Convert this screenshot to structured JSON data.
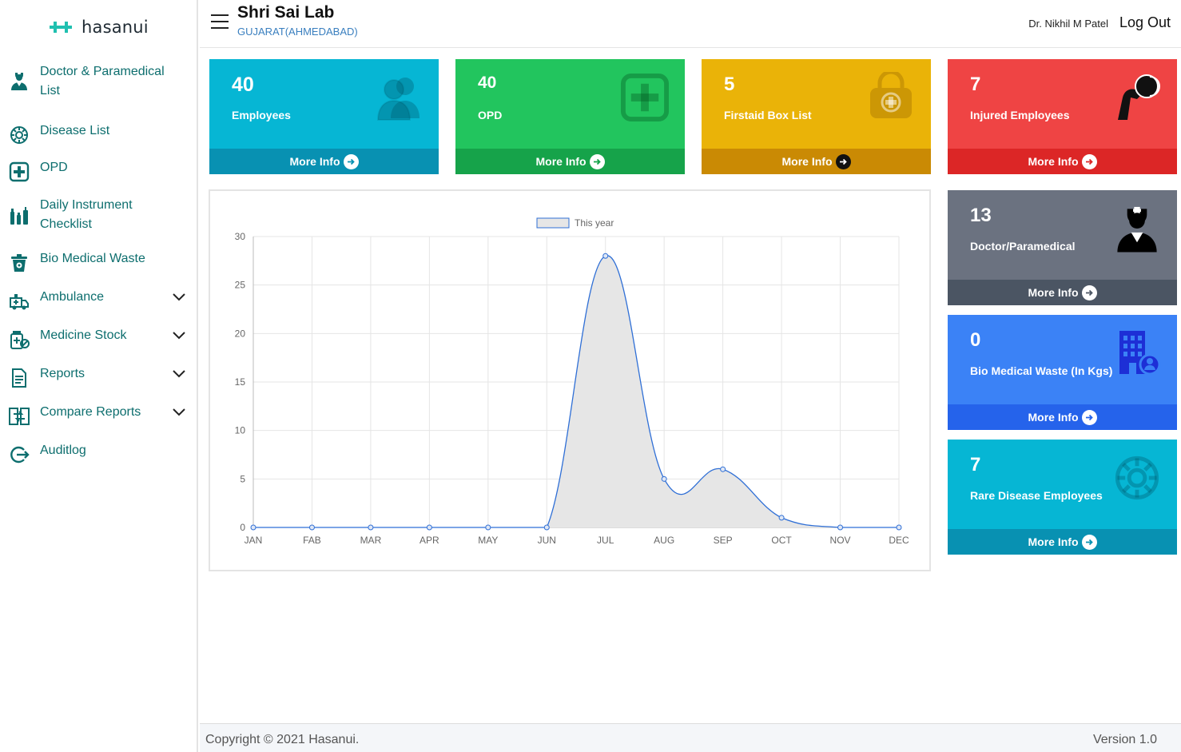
{
  "brand": {
    "name": "hasanui"
  },
  "sidebar": {
    "items": [
      {
        "label": "Doctor & Paramedical List",
        "icon": "doctor-icon",
        "has_chevron": false
      },
      {
        "label": "Disease List",
        "icon": "virus-icon",
        "has_chevron": false
      },
      {
        "label": "OPD",
        "icon": "medical-plus-icon",
        "has_chevron": false
      },
      {
        "label": "Daily Instrument Checklist",
        "icon": "instruments-icon",
        "has_chevron": false
      },
      {
        "label": "Bio Medical Waste",
        "icon": "waste-bin-icon",
        "has_chevron": false
      },
      {
        "label": "Ambulance",
        "icon": "ambulance-icon",
        "has_chevron": true
      },
      {
        "label": "Medicine Stock",
        "icon": "medicine-icon",
        "has_chevron": true
      },
      {
        "label": "Reports",
        "icon": "report-icon",
        "has_chevron": true
      },
      {
        "label": "Compare Reports",
        "icon": "compare-icon",
        "has_chevron": true
      },
      {
        "label": "Auditlog",
        "icon": "logout-arrow-icon",
        "has_chevron": false
      }
    ]
  },
  "header": {
    "title": "Shri Sai Lab",
    "subtitle": "GUJARAT(AHMEDABAD)",
    "user": "Dr. Nikhil M Patel",
    "logout": "Log Out"
  },
  "cards": [
    {
      "value": "40",
      "label": "Employees",
      "more": "More Info",
      "color": "#06b6d4",
      "footer_color": "#0891b2",
      "icon": "users-icon"
    },
    {
      "value": "40",
      "label": "OPD",
      "more": "More Info",
      "color": "#22c55e",
      "footer_color": "#16a34a",
      "icon": "medical-plus-icon"
    },
    {
      "value": "5",
      "label": "Firstaid Box List",
      "more": "More Info",
      "color": "#eab308",
      "footer_color": "#ca8a04",
      "icon": "firstaid-bag-icon"
    },
    {
      "value": "7",
      "label": "Injured Employees",
      "more": "More Info",
      "color": "#ef4444",
      "footer_color": "#dc2626",
      "icon": "injured-arm-icon"
    },
    {
      "value": "13",
      "label": "Doctor/Paramedical",
      "more": "More Info",
      "color": "#6b7280",
      "footer_color": "#4b5563",
      "icon": "doctor-icon"
    },
    {
      "value": "0",
      "label": "Bio Medical Waste (In Kgs)",
      "more": "More Info",
      "color": "#3b82f6",
      "footer_color": "#2563eb",
      "icon": "hospital-building-icon"
    },
    {
      "value": "7",
      "label": "Rare Disease Employees",
      "more": "More Info",
      "color": "#06b6d4",
      "footer_color": "#0891b2",
      "icon": "virus-icon"
    }
  ],
  "chart_data": {
    "type": "area",
    "categories": [
      "JAN",
      "FAB",
      "MAR",
      "APR",
      "MAY",
      "JUN",
      "JUL",
      "AUG",
      "SEP",
      "OCT",
      "NOV",
      "DEC"
    ],
    "series": [
      {
        "name": "This year",
        "values": [
          0,
          0,
          0,
          0,
          0,
          0,
          28,
          5,
          6,
          1,
          0,
          0
        ]
      }
    ],
    "ylim": [
      0,
      30
    ],
    "yticks": [
      0,
      5,
      10,
      15,
      20,
      25,
      30
    ],
    "grid": true,
    "legend": "top",
    "line_color": "#2f6fd6",
    "fill_color": "#e6e6e6"
  },
  "footer": {
    "copyright": "Copyright © 2021 Hasanui.",
    "version": "Version 1.0"
  }
}
